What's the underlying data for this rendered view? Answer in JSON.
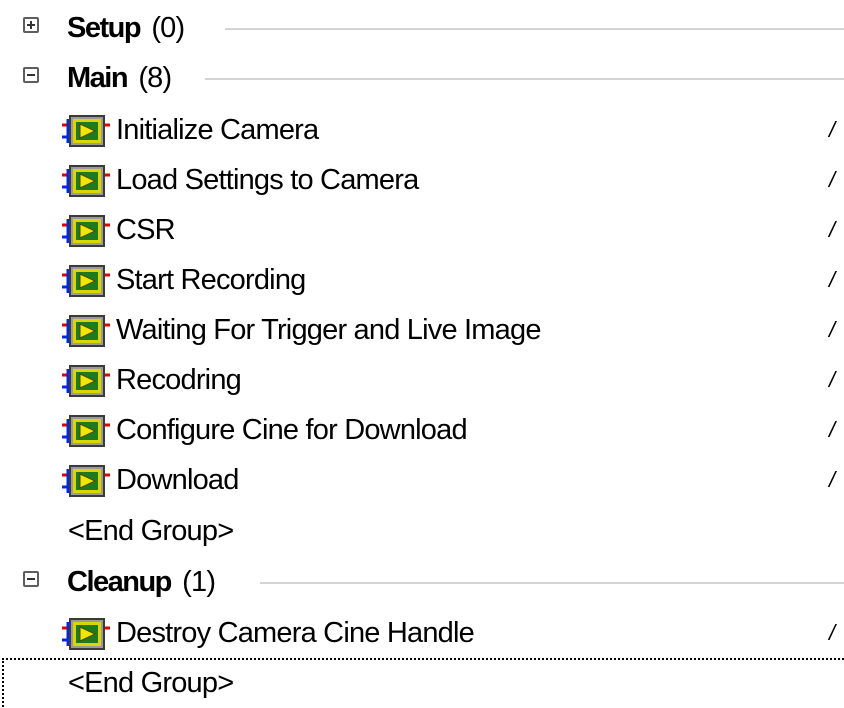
{
  "groups": [
    {
      "name": "Setup",
      "count": "(0)",
      "expanded": false
    },
    {
      "name": "Main",
      "count": "(8)",
      "expanded": true
    },
    {
      "name": "Cleanup",
      "count": "(1)",
      "expanded": true
    }
  ],
  "main_steps": [
    {
      "label": "Initialize Camera",
      "mark": "/"
    },
    {
      "label": "Load Settings to Camera",
      "mark": "/"
    },
    {
      "label": "CSR",
      "mark": "/"
    },
    {
      "label": "Start Recording",
      "mark": "/"
    },
    {
      "label": "Waiting For Trigger and Live Image",
      "mark": "/"
    },
    {
      "label": "Recodring",
      "mark": "/"
    },
    {
      "label": "Configure Cine for Download",
      "mark": "/"
    },
    {
      "label": "Download",
      "mark": "/"
    }
  ],
  "cleanup_steps": [
    {
      "label": "Destroy Camera Cine Handle",
      "mark": "/"
    }
  ],
  "end_group_label": "<End Group>",
  "icon": {
    "name": "vi-step-icon"
  },
  "colors": {
    "icon_yellow": "#f2e600",
    "icon_green": "#1f7a1f",
    "wire_red": "#e00000",
    "wire_blue": "#0028e0",
    "group_line": "#d4d4d4"
  }
}
